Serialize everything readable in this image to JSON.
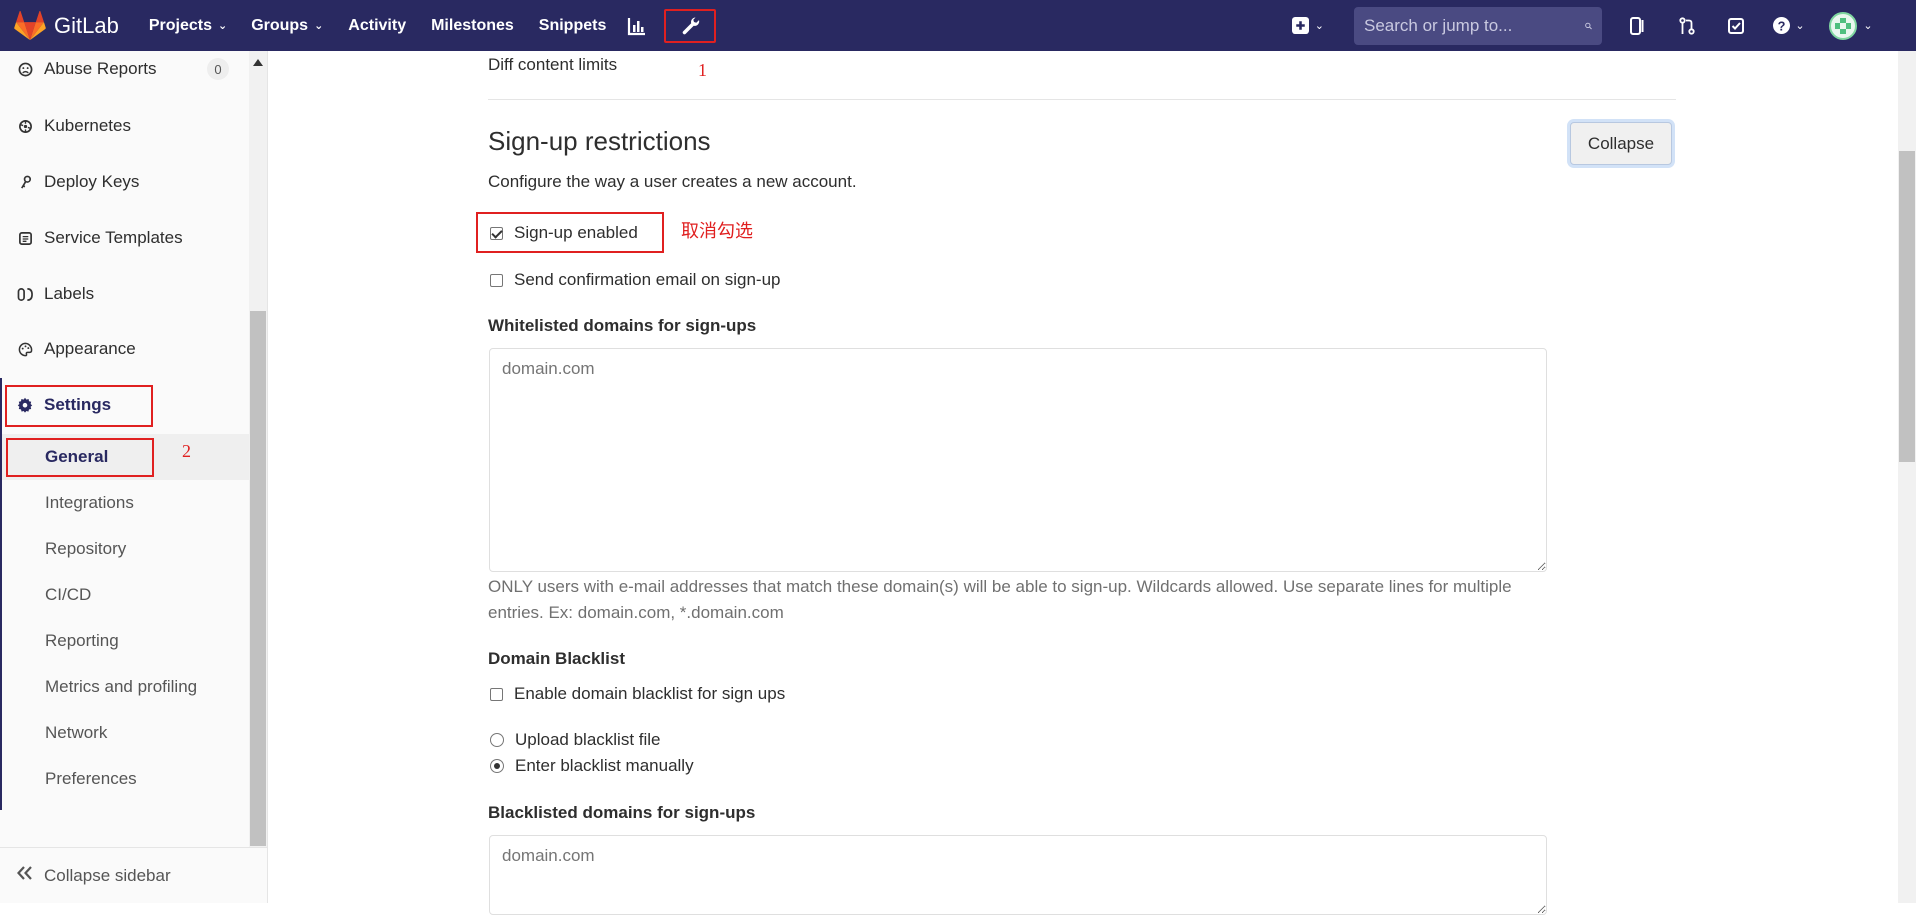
{
  "navbar": {
    "brand": "GitLab",
    "items": [
      {
        "label": "Projects",
        "has_dropdown": true
      },
      {
        "label": "Groups",
        "has_dropdown": true
      },
      {
        "label": "Activity",
        "has_dropdown": false
      },
      {
        "label": "Milestones",
        "has_dropdown": false
      },
      {
        "label": "Snippets",
        "has_dropdown": false
      }
    ],
    "search_placeholder": "Search or jump to...",
    "annotation_number": "1",
    "colors": {
      "background": "#292961",
      "annotation": "#e02020"
    }
  },
  "sidebar": {
    "items": [
      {
        "label": "Abuse Reports",
        "icon": "abuse-icon",
        "badge": "0"
      },
      {
        "label": "Kubernetes",
        "icon": "kubernetes-icon"
      },
      {
        "label": "Deploy Keys",
        "icon": "key-icon"
      },
      {
        "label": "Service Templates",
        "icon": "template-icon"
      },
      {
        "label": "Labels",
        "icon": "labels-icon"
      },
      {
        "label": "Appearance",
        "icon": "palette-icon"
      },
      {
        "label": "Settings",
        "icon": "gear-icon"
      }
    ],
    "settings_sub_items": [
      "General",
      "Integrations",
      "Repository",
      "CI/CD",
      "Reporting",
      "Metrics and profiling",
      "Network",
      "Preferences"
    ],
    "active_sub_item": "General",
    "annotation_number": "2",
    "collapse_label": "Collapse sidebar"
  },
  "main": {
    "diff_label": "Diff content limits",
    "section_title": "Sign-up restrictions",
    "collapse_button": "Collapse",
    "section_desc": "Configure the way a user creates a new account.",
    "signup_enabled": {
      "label": "Sign-up enabled",
      "checked": true,
      "annotation": "取消勾选"
    },
    "send_confirmation": {
      "label": "Send confirmation email on sign-up",
      "checked": false
    },
    "whitelist_label": "Whitelisted domains for sign-ups",
    "whitelist_placeholder": "domain.com",
    "whitelist_help": "ONLY users with e-mail addresses that match these domain(s) will be able to sign-up. Wildcards allowed. Use separate lines for multiple entries. Ex: domain.com, *.domain.com",
    "blacklist_section": "Domain Blacklist",
    "enable_blacklist": {
      "label": "Enable domain blacklist for sign ups",
      "checked": false
    },
    "upload_blacklist": {
      "label": "Upload blacklist file",
      "checked": false
    },
    "enter_blacklist": {
      "label": "Enter blacklist manually",
      "checked": true
    },
    "blacklisted_label": "Blacklisted domains for sign-ups",
    "blacklisted_placeholder": "domain.com"
  }
}
